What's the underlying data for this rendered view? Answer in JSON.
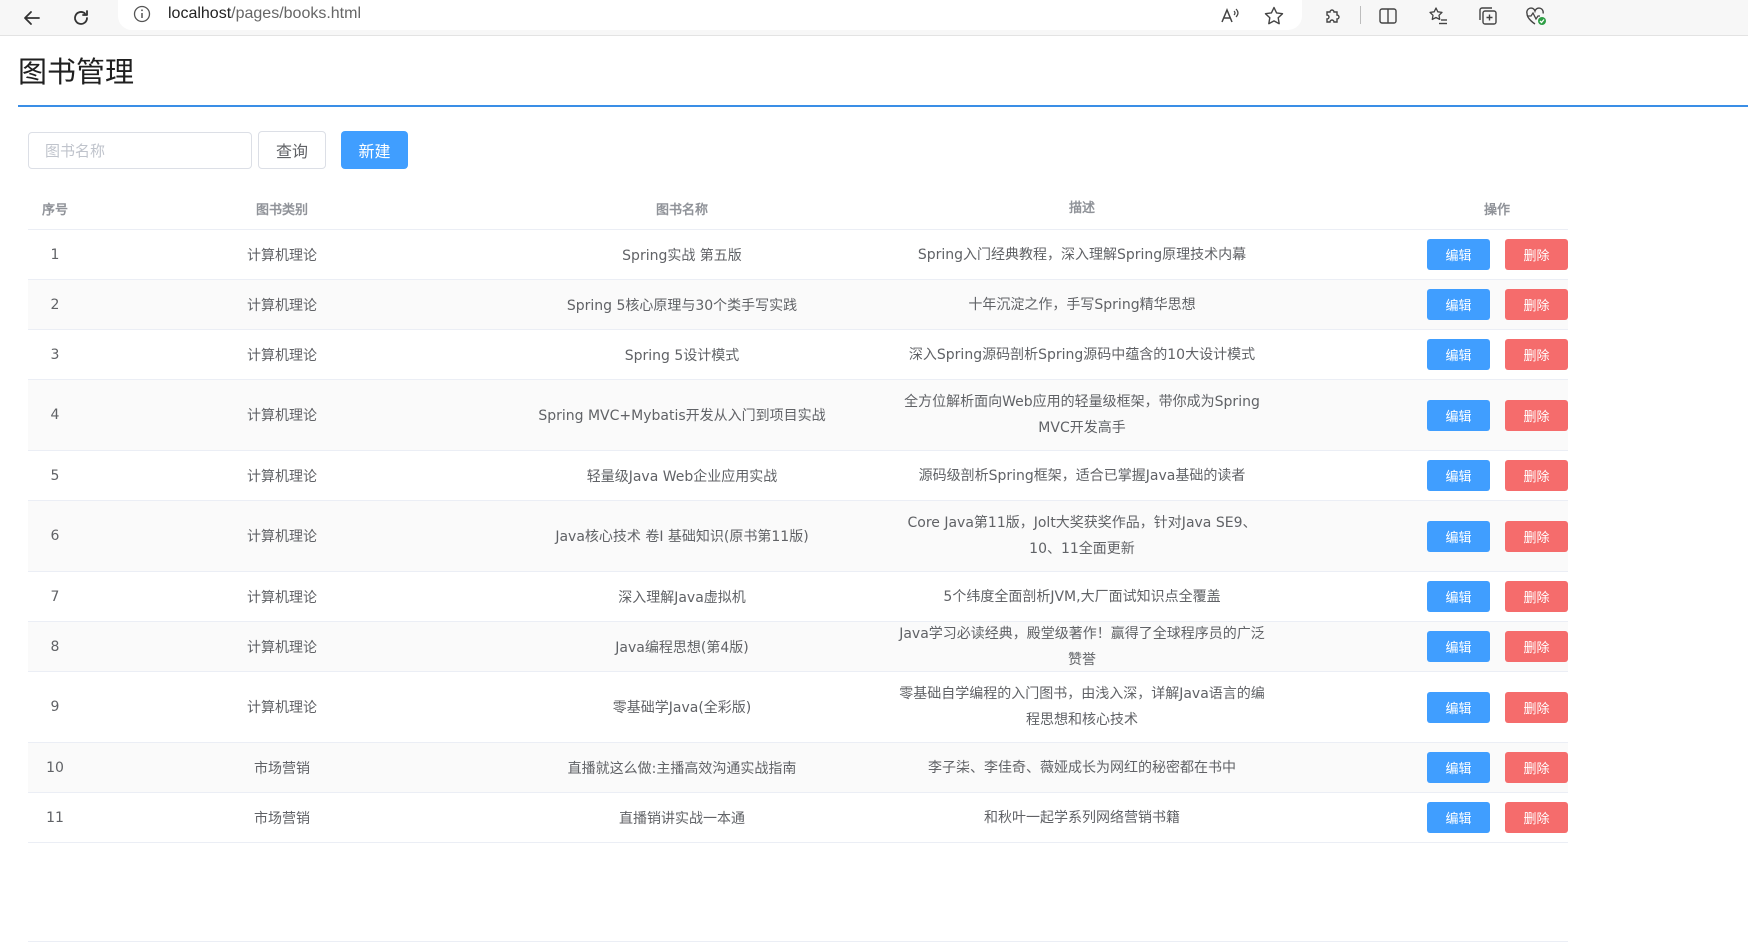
{
  "browser": {
    "url_host": "localhost",
    "url_path": "/pages/books.html"
  },
  "page": {
    "title": "图书管理"
  },
  "search": {
    "placeholder": "图书名称",
    "value": "",
    "query_label": "查询",
    "new_label": "新建"
  },
  "table": {
    "headers": {
      "index": "序号",
      "category": "图书类别",
      "name": "图书名称",
      "description": "描述",
      "operations": "操作"
    },
    "edit_label": "编辑",
    "delete_label": "删除",
    "rows": [
      {
        "index": "1",
        "category": "计算机理论",
        "name": "Spring实战 第五版",
        "description": "Spring入门经典教程，深入理解Spring原理技术内幕"
      },
      {
        "index": "2",
        "category": "计算机理论",
        "name": "Spring 5核心原理与30个类手写实践",
        "description": "十年沉淀之作，手写Spring精华思想"
      },
      {
        "index": "3",
        "category": "计算机理论",
        "name": "Spring 5设计模式",
        "description": "深入Spring源码剖析Spring源码中蕴含的10大设计模式"
      },
      {
        "index": "4",
        "category": "计算机理论",
        "name": "Spring MVC+Mybatis开发从入门到项目实战",
        "description": "全方位解析面向Web应用的轻量级框架，带你成为Spring MVC开发高手"
      },
      {
        "index": "5",
        "category": "计算机理论",
        "name": "轻量级Java Web企业应用实战",
        "description": "源码级剖析Spring框架，适合已掌握Java基础的读者"
      },
      {
        "index": "6",
        "category": "计算机理论",
        "name": "Java核心技术 卷Ⅰ 基础知识(原书第11版)",
        "description": "Core Java第11版，Jolt大奖获奖作品，针对Java SE9、10、11全面更新"
      },
      {
        "index": "7",
        "category": "计算机理论",
        "name": "深入理解Java虚拟机",
        "description": "5个纬度全面剖析JVM,大厂面试知识点全覆盖"
      },
      {
        "index": "8",
        "category": "计算机理论",
        "name": "Java编程思想(第4版)",
        "description": "Java学习必读经典，殿堂级著作！赢得了全球程序员的广泛赞誉"
      },
      {
        "index": "9",
        "category": "计算机理论",
        "name": "零基础学Java(全彩版)",
        "description": "零基础自学编程的入门图书，由浅入深，详解Java语言的编程思想和核心技术"
      },
      {
        "index": "10",
        "category": "市场营销",
        "name": "直播就这么做:主播高效沟通实战指南",
        "description": "李子柒、李佳奇、薇娅成长为网红的秘密都在书中"
      },
      {
        "index": "11",
        "category": "市场营销",
        "name": "直播销讲实战一本通",
        "description": "和秋叶一起学系列网络营销书籍"
      }
    ]
  },
  "colors": {
    "primary": "#409eff",
    "danger": "#f56c6c",
    "title_rule": "#3a8ee6"
  }
}
